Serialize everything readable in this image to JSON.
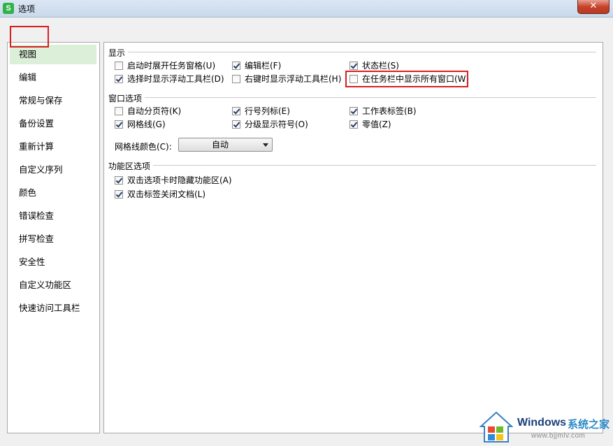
{
  "window": {
    "title": "选项",
    "app_icon_letter": "S",
    "close_label": "✕"
  },
  "sidebar": {
    "items": [
      {
        "label": "视图",
        "active": true
      },
      {
        "label": "编辑"
      },
      {
        "label": "常规与保存"
      },
      {
        "label": "备份设置"
      },
      {
        "label": "重新计算"
      },
      {
        "label": "自定义序列"
      },
      {
        "label": "颜色"
      },
      {
        "label": "错误检查"
      },
      {
        "label": "拼写检查"
      },
      {
        "label": "安全性"
      },
      {
        "label": "自定义功能区"
      },
      {
        "label": "快速访问工具栏"
      }
    ]
  },
  "sections": {
    "display": {
      "title": "显示",
      "options": [
        {
          "label": "启动时展开任务窗格(U)",
          "checked": false
        },
        {
          "label": "编辑栏(F)",
          "checked": true
        },
        {
          "label": "状态栏(S)",
          "checked": true
        },
        {
          "label": "选择时显示浮动工具栏(D)",
          "checked": true
        },
        {
          "label": "右键时显示浮动工具栏(H)",
          "checked": false
        },
        {
          "label": "在任务栏中显示所有窗口(W)",
          "checked": false
        }
      ]
    },
    "window_options": {
      "title": "窗口选项",
      "options": [
        {
          "label": "自动分页符(K)",
          "checked": false
        },
        {
          "label": "行号列标(E)",
          "checked": true
        },
        {
          "label": "工作表标签(B)",
          "checked": true
        },
        {
          "label": "网格线(G)",
          "checked": true
        },
        {
          "label": "分级显示符号(O)",
          "checked": true
        },
        {
          "label": "零值(Z)",
          "checked": true
        }
      ],
      "gridline_color": {
        "label": "网格线颜色(C):",
        "value": "自动"
      }
    },
    "ribbon_options": {
      "title": "功能区选项",
      "options": [
        {
          "label": "双击选项卡时隐藏功能区(A)",
          "checked": true
        },
        {
          "label": "双击标签关闭文档(L)",
          "checked": true
        }
      ]
    }
  },
  "watermark": {
    "brand": "Windows",
    "cn_text": "系统之家",
    "url": "www.bjjmlv.com"
  },
  "colors": {
    "highlight_red": "#d61f1f",
    "active_item_bg": "#dcefd8",
    "app_icon_green": "#2fb346"
  }
}
